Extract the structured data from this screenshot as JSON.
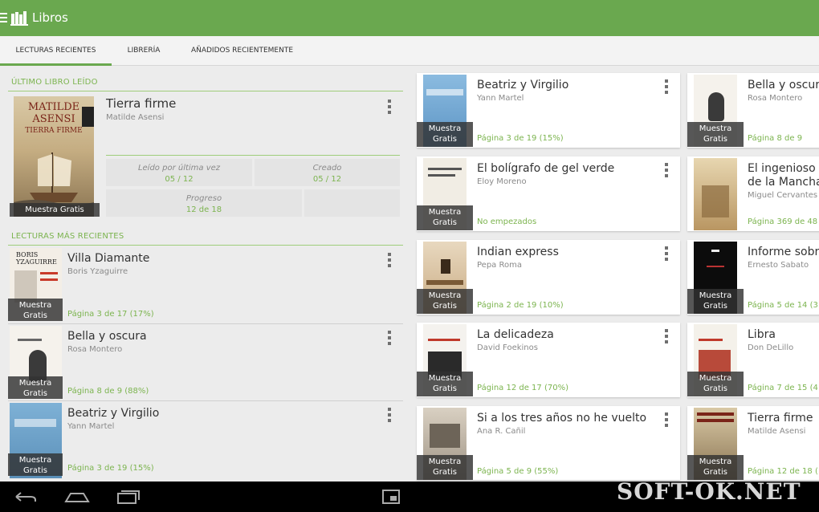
{
  "colors": {
    "accent": "#6aa84f",
    "progress": "#7cb44f"
  },
  "app": {
    "title": "Libros",
    "menu_icon": "hamburger-icon",
    "logo_icon": "library-books-icon"
  },
  "tabs": [
    {
      "label": "LECTURAS RECIENTES",
      "active": true
    },
    {
      "label": "LIBRERÍA",
      "active": false
    },
    {
      "label": "AÑADIDOS RECIENTEMENTE",
      "active": false
    }
  ],
  "last_read": {
    "section_title": "ÚLTIMO LIBRO LEÍDO",
    "title": "Tierra firme",
    "author": "Matilde Asensi",
    "badge": "Muestra Gratis",
    "cover_text": {
      "line1": "MATILDE",
      "line2": "ASENSI",
      "line3": "TIERRA FIRME"
    },
    "stats": {
      "last_read_label": "Leído por última vez",
      "last_read_value": "05 / 12",
      "created_label": "Creado",
      "created_value": "05 / 12",
      "progress_label": "Progreso",
      "progress_value": "12 de 18"
    }
  },
  "recent": {
    "section_title": "LECTURAS MÁS RECIENTES",
    "items": [
      {
        "title": "Villa Diamante",
        "author": "Boris Yzaguirre",
        "progress": "Página 3 de 17 (17%)",
        "badge": "Muestra Gratis"
      },
      {
        "title": "Bella y oscura",
        "author": "Rosa Montero",
        "progress": "Página 8 de 9 (88%)",
        "badge": "Muestra Gratis"
      },
      {
        "title": "Beatriz y Virgilio",
        "author": "Yann Martel",
        "progress": "Página 3 de 19 (15%)",
        "badge": "Muestra Gratis"
      }
    ]
  },
  "grid": {
    "col1": [
      {
        "title": "Beatriz y Virgilio",
        "author": "Yann Martel",
        "progress": "Página 3 de 19 (15%)",
        "badge": "Muestra Gratis"
      },
      {
        "title": "El bolígrafo de gel verde",
        "author": "Eloy Moreno",
        "progress": "No empezados",
        "badge": "Muestra Gratis"
      },
      {
        "title": "Indian express",
        "author": "Pepa Roma",
        "progress": "Página 2 de 19 (10%)",
        "badge": "Muestra Gratis"
      },
      {
        "title": "La delicadeza",
        "author": "David Foekinos",
        "progress": "Página 12 de 17 (70%)",
        "badge": "Muestra Gratis"
      },
      {
        "title": "Si a los tres años no he vuelto",
        "author": "Ana R. Cañil",
        "progress": "Página 5 de 9 (55%)",
        "badge": "Muestra Gratis"
      }
    ],
    "col2": [
      {
        "title": "Bella y oscura",
        "author": "Rosa Montero",
        "progress": "Página 8 de 9",
        "badge": "Muestra Gratis"
      },
      {
        "title": "El ingenioso h",
        "title2": "de la Mancha",
        "author": "Miguel Cervantes",
        "progress": "Página 369 de 48",
        "badge": "Muestra Gratis"
      },
      {
        "title": "Informe sobre",
        "author": "Ernesto Sabato",
        "progress": "Página 5 de 14 (3",
        "badge": "Muestra Gratis"
      },
      {
        "title": "Libra",
        "author": "Don DeLillo",
        "progress": "Página 7 de 15 (4",
        "badge": "Muestra Gratis"
      },
      {
        "title": "Tierra firme",
        "author": "Matilde Asensi",
        "progress": "Página 12 de 18 (",
        "badge": "Muestra Gratis"
      }
    ]
  },
  "navbar": {
    "icons": [
      "back-icon",
      "home-icon",
      "recent-apps-icon",
      "screen-icon"
    ]
  },
  "watermark": "SOFT-OK.NET"
}
